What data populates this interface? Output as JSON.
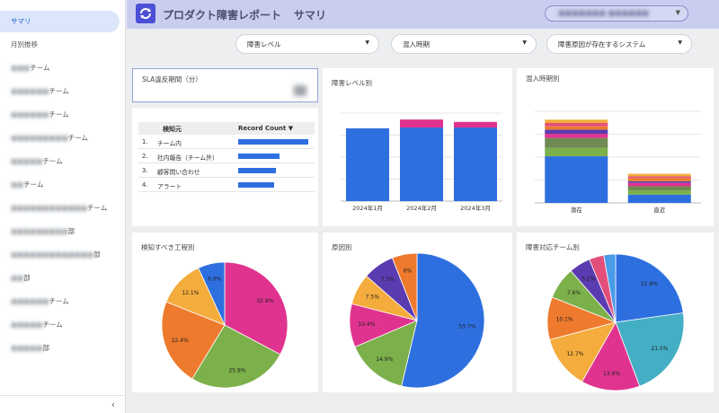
{
  "header": {
    "title": "プロダクト障害レポート",
    "page_name": "サマリ"
  },
  "sidebar": {
    "items": [
      {
        "label": "サマリ",
        "active": true
      },
      {
        "label": "月別推移"
      },
      {
        "prefix": "■■■",
        "label": "チーム"
      },
      {
        "prefix": "■■■■■■",
        "label": "チーム"
      },
      {
        "prefix": "■■■■■■",
        "label": "チーム"
      },
      {
        "prefix": "■■■■■■■■■",
        "label": "チーム"
      },
      {
        "prefix": "■■■■■",
        "label": "チーム"
      },
      {
        "prefix": "■■",
        "label": "チーム"
      },
      {
        "prefix": "■■■■■■■■■■■■",
        "label": "チーム"
      },
      {
        "prefix": "■■■■■■■■■",
        "label": "部"
      },
      {
        "prefix": "■■■■■■■■■■■■■",
        "label": "部"
      },
      {
        "prefix": "■■",
        "label": "部"
      },
      {
        "prefix": "■■■■■■",
        "label": "チーム"
      },
      {
        "prefix": "■■■■■",
        "label": "チーム"
      },
      {
        "prefix": "■■■■■",
        "label": "部"
      }
    ],
    "collapse_icon": "chevron-left"
  },
  "filters": [
    {
      "label": "障害レベル"
    },
    {
      "label": "混入時期"
    },
    {
      "label": "障害原因が存在するシステム"
    }
  ],
  "cards": {
    "sla": {
      "title": "SLA違反期間（分）"
    },
    "detect": {
      "header": {
        "col1": "検知元",
        "col2": "Record Count ▼"
      },
      "rows": [
        {
          "num": "1.",
          "name": "チーム内",
          "value": 78
        },
        {
          "num": "2.",
          "name": "社内報告（チーム外）",
          "value": 46
        },
        {
          "num": "3.",
          "name": "顧客問い合わせ",
          "value": 42
        },
        {
          "num": "4.",
          "name": "アラート",
          "value": 40
        }
      ]
    },
    "level": {
      "title": "障害レベル別"
    },
    "period": {
      "title": "混入時期別"
    },
    "process": {
      "title": "検知すべき工程別"
    },
    "cause": {
      "title": "原因別"
    },
    "team": {
      "title": "障害対応チーム別"
    }
  },
  "colors": {
    "blue": "#2e6fe0",
    "magenta": "#e0338f",
    "green": "#7cb04a",
    "orange": "#ee7a2d",
    "yellow": "#f4ac3c",
    "purple": "#5b3bb0",
    "teal": "#44aec4",
    "pink": "#e24f7a",
    "lightblue": "#4a9be8",
    "olive": "#6f8a52"
  },
  "chart_data": [
    {
      "type": "bar",
      "id": "level",
      "categories": [
        "2024年1月",
        "2024年2月",
        "2024年3月"
      ],
      "series": [
        {
          "values": [
            91,
            92,
            92
          ],
          "color": "#2e6fe0"
        },
        {
          "values": [
            0,
            10,
            7
          ],
          "color": "#e0338f"
        }
      ],
      "ylim": [
        0,
        110
      ]
    },
    {
      "type": "bar",
      "id": "period",
      "categories": [
        "潜在",
        "直近"
      ],
      "series": [
        {
          "values": [
            56,
            10
          ],
          "color": "#2e6fe0"
        },
        {
          "values": [
            10,
            5
          ],
          "color": "#7cb04a"
        },
        {
          "values": [
            12,
            5
          ],
          "color": "#6f8a52"
        },
        {
          "values": [
            5,
            4
          ],
          "color": "#e0338f"
        },
        {
          "values": [
            5,
            2
          ],
          "color": "#5b3bb0"
        },
        {
          "values": [
            4,
            4
          ],
          "color": "#ee7a2d"
        },
        {
          "values": [
            4,
            2
          ],
          "color": "#e24f7a"
        },
        {
          "values": [
            4,
            3
          ],
          "color": "#f4ac3c"
        }
      ],
      "ylim": [
        0,
        110
      ]
    },
    {
      "type": "pie",
      "id": "process",
      "slices": [
        {
          "value": 32.8,
          "label": "32.8%",
          "color": "#e0338f"
        },
        {
          "value": 25.9,
          "label": "25.9%",
          "color": "#7cb04a"
        },
        {
          "value": 22.4,
          "label": "22.4%",
          "color": "#ee7a2d"
        },
        {
          "value": 12.1,
          "label": "12.1%",
          "color": "#f4ac3c"
        },
        {
          "value": 6.9,
          "label": "6.9%",
          "color": "#2e6fe0"
        }
      ]
    },
    {
      "type": "pie",
      "id": "cause",
      "slices": [
        {
          "value": 53.7,
          "label": "53.7%",
          "color": "#2e6fe0"
        },
        {
          "value": 14.9,
          "label": "14.9%",
          "color": "#7cb04a"
        },
        {
          "value": 10.4,
          "label": "10.4%",
          "color": "#e0338f"
        },
        {
          "value": 7.5,
          "label": "7.5%",
          "color": "#f4ac3c"
        },
        {
          "value": 7.5,
          "label": "7.5%",
          "color": "#5b3bb0"
        },
        {
          "value": 6.0,
          "label": "6%",
          "color": "#ee7a2d"
        }
      ]
    },
    {
      "type": "pie",
      "id": "team",
      "slices": [
        {
          "value": 22.8,
          "label": "22.8%",
          "color": "#2e6fe0"
        },
        {
          "value": 21.5,
          "label": "21.5%",
          "color": "#44aec4"
        },
        {
          "value": 13.9,
          "label": "13.9%",
          "color": "#e0338f"
        },
        {
          "value": 12.7,
          "label": "12.7%",
          "color": "#f4ac3c"
        },
        {
          "value": 10.1,
          "label": "10.1%",
          "color": "#ee7a2d"
        },
        {
          "value": 7.6,
          "label": "7.6%",
          "color": "#7cb04a"
        },
        {
          "value": 5.1,
          "label": "5.1%",
          "color": "#5b3bb0"
        },
        {
          "value": 3.5,
          "label": "",
          "color": "#e24f7a"
        },
        {
          "value": 2.8,
          "label": "",
          "color": "#4a9be8"
        }
      ]
    }
  ]
}
